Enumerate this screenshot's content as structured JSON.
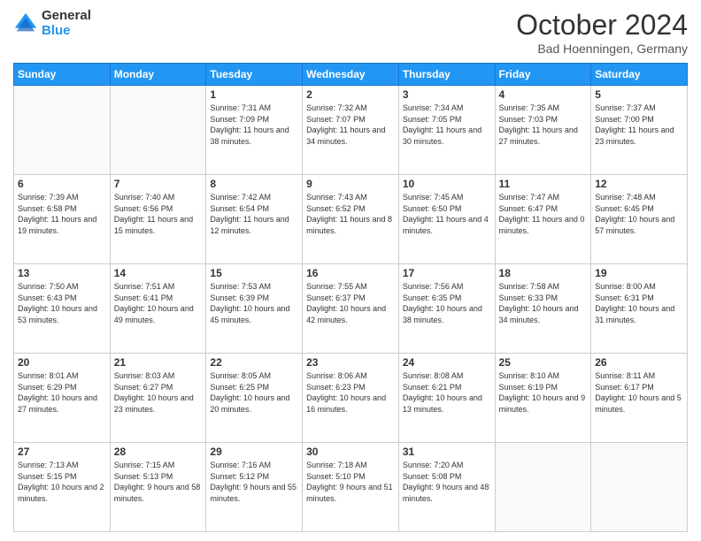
{
  "logo": {
    "general": "General",
    "blue": "Blue"
  },
  "title": "October 2024",
  "location": "Bad Hoenningen, Germany",
  "days": [
    "Sunday",
    "Monday",
    "Tuesday",
    "Wednesday",
    "Thursday",
    "Friday",
    "Saturday"
  ],
  "weeks": [
    [
      {
        "day": "",
        "sunrise": "",
        "sunset": "",
        "daylight": ""
      },
      {
        "day": "",
        "sunrise": "",
        "sunset": "",
        "daylight": ""
      },
      {
        "day": "1",
        "sunrise": "Sunrise: 7:31 AM",
        "sunset": "Sunset: 7:09 PM",
        "daylight": "Daylight: 11 hours and 38 minutes."
      },
      {
        "day": "2",
        "sunrise": "Sunrise: 7:32 AM",
        "sunset": "Sunset: 7:07 PM",
        "daylight": "Daylight: 11 hours and 34 minutes."
      },
      {
        "day": "3",
        "sunrise": "Sunrise: 7:34 AM",
        "sunset": "Sunset: 7:05 PM",
        "daylight": "Daylight: 11 hours and 30 minutes."
      },
      {
        "day": "4",
        "sunrise": "Sunrise: 7:35 AM",
        "sunset": "Sunset: 7:03 PM",
        "daylight": "Daylight: 11 hours and 27 minutes."
      },
      {
        "day": "5",
        "sunrise": "Sunrise: 7:37 AM",
        "sunset": "Sunset: 7:00 PM",
        "daylight": "Daylight: 11 hours and 23 minutes."
      }
    ],
    [
      {
        "day": "6",
        "sunrise": "Sunrise: 7:39 AM",
        "sunset": "Sunset: 6:58 PM",
        "daylight": "Daylight: 11 hours and 19 minutes."
      },
      {
        "day": "7",
        "sunrise": "Sunrise: 7:40 AM",
        "sunset": "Sunset: 6:56 PM",
        "daylight": "Daylight: 11 hours and 15 minutes."
      },
      {
        "day": "8",
        "sunrise": "Sunrise: 7:42 AM",
        "sunset": "Sunset: 6:54 PM",
        "daylight": "Daylight: 11 hours and 12 minutes."
      },
      {
        "day": "9",
        "sunrise": "Sunrise: 7:43 AM",
        "sunset": "Sunset: 6:52 PM",
        "daylight": "Daylight: 11 hours and 8 minutes."
      },
      {
        "day": "10",
        "sunrise": "Sunrise: 7:45 AM",
        "sunset": "Sunset: 6:50 PM",
        "daylight": "Daylight: 11 hours and 4 minutes."
      },
      {
        "day": "11",
        "sunrise": "Sunrise: 7:47 AM",
        "sunset": "Sunset: 6:47 PM",
        "daylight": "Daylight: 11 hours and 0 minutes."
      },
      {
        "day": "12",
        "sunrise": "Sunrise: 7:48 AM",
        "sunset": "Sunset: 6:45 PM",
        "daylight": "Daylight: 10 hours and 57 minutes."
      }
    ],
    [
      {
        "day": "13",
        "sunrise": "Sunrise: 7:50 AM",
        "sunset": "Sunset: 6:43 PM",
        "daylight": "Daylight: 10 hours and 53 minutes."
      },
      {
        "day": "14",
        "sunrise": "Sunrise: 7:51 AM",
        "sunset": "Sunset: 6:41 PM",
        "daylight": "Daylight: 10 hours and 49 minutes."
      },
      {
        "day": "15",
        "sunrise": "Sunrise: 7:53 AM",
        "sunset": "Sunset: 6:39 PM",
        "daylight": "Daylight: 10 hours and 45 minutes."
      },
      {
        "day": "16",
        "sunrise": "Sunrise: 7:55 AM",
        "sunset": "Sunset: 6:37 PM",
        "daylight": "Daylight: 10 hours and 42 minutes."
      },
      {
        "day": "17",
        "sunrise": "Sunrise: 7:56 AM",
        "sunset": "Sunset: 6:35 PM",
        "daylight": "Daylight: 10 hours and 38 minutes."
      },
      {
        "day": "18",
        "sunrise": "Sunrise: 7:58 AM",
        "sunset": "Sunset: 6:33 PM",
        "daylight": "Daylight: 10 hours and 34 minutes."
      },
      {
        "day": "19",
        "sunrise": "Sunrise: 8:00 AM",
        "sunset": "Sunset: 6:31 PM",
        "daylight": "Daylight: 10 hours and 31 minutes."
      }
    ],
    [
      {
        "day": "20",
        "sunrise": "Sunrise: 8:01 AM",
        "sunset": "Sunset: 6:29 PM",
        "daylight": "Daylight: 10 hours and 27 minutes."
      },
      {
        "day": "21",
        "sunrise": "Sunrise: 8:03 AM",
        "sunset": "Sunset: 6:27 PM",
        "daylight": "Daylight: 10 hours and 23 minutes."
      },
      {
        "day": "22",
        "sunrise": "Sunrise: 8:05 AM",
        "sunset": "Sunset: 6:25 PM",
        "daylight": "Daylight: 10 hours and 20 minutes."
      },
      {
        "day": "23",
        "sunrise": "Sunrise: 8:06 AM",
        "sunset": "Sunset: 6:23 PM",
        "daylight": "Daylight: 10 hours and 16 minutes."
      },
      {
        "day": "24",
        "sunrise": "Sunrise: 8:08 AM",
        "sunset": "Sunset: 6:21 PM",
        "daylight": "Daylight: 10 hours and 13 minutes."
      },
      {
        "day": "25",
        "sunrise": "Sunrise: 8:10 AM",
        "sunset": "Sunset: 6:19 PM",
        "daylight": "Daylight: 10 hours and 9 minutes."
      },
      {
        "day": "26",
        "sunrise": "Sunrise: 8:11 AM",
        "sunset": "Sunset: 6:17 PM",
        "daylight": "Daylight: 10 hours and 5 minutes."
      }
    ],
    [
      {
        "day": "27",
        "sunrise": "Sunrise: 7:13 AM",
        "sunset": "Sunset: 5:15 PM",
        "daylight": "Daylight: 10 hours and 2 minutes."
      },
      {
        "day": "28",
        "sunrise": "Sunrise: 7:15 AM",
        "sunset": "Sunset: 5:13 PM",
        "daylight": "Daylight: 9 hours and 58 minutes."
      },
      {
        "day": "29",
        "sunrise": "Sunrise: 7:16 AM",
        "sunset": "Sunset: 5:12 PM",
        "daylight": "Daylight: 9 hours and 55 minutes."
      },
      {
        "day": "30",
        "sunrise": "Sunrise: 7:18 AM",
        "sunset": "Sunset: 5:10 PM",
        "daylight": "Daylight: 9 hours and 51 minutes."
      },
      {
        "day": "31",
        "sunrise": "Sunrise: 7:20 AM",
        "sunset": "Sunset: 5:08 PM",
        "daylight": "Daylight: 9 hours and 48 minutes."
      },
      {
        "day": "",
        "sunrise": "",
        "sunset": "",
        "daylight": ""
      },
      {
        "day": "",
        "sunrise": "",
        "sunset": "",
        "daylight": ""
      }
    ]
  ]
}
